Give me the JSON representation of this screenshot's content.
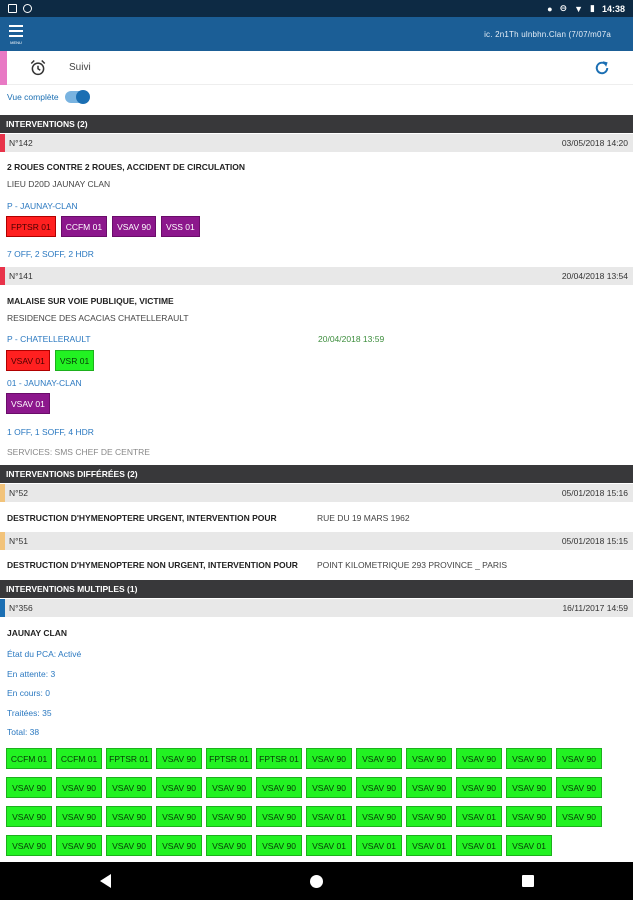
{
  "status": {
    "time": "14:38"
  },
  "appbar": {
    "menu_label": "MENU",
    "user": "ic. 2n1Th ulnbhn.Clan (7/07/m07a"
  },
  "toolbar": {
    "title": "Suivi"
  },
  "view": {
    "label": "Vue complète"
  },
  "sections": {
    "interventions": "INTERVENTIONS (2)",
    "differees": "INTERVENTIONS DIFFÉRÉES (2)",
    "multiples": "INTERVENTIONS MULTIPLES (1)"
  },
  "i142": {
    "num": "N°142",
    "date": "03/05/2018 14:20",
    "title": "2 ROUES CONTRE 2 ROUES, ACCIDENT DE CIRCULATION",
    "address": "LIEU D20D JAUNAY CLAN",
    "station": "P - JAUNAY-CLAN",
    "badges": [
      "FPTSR 01",
      "CCFM 01",
      "VSAV 90",
      "VSS 01"
    ],
    "personnel": "7 OFF, 2 SOFF, 2 HDR"
  },
  "i141": {
    "num": "N°141",
    "date": "20/04/2018 13:54",
    "title": "MALAISE SUR VOIE PUBLIQUE, VICTIME",
    "address": "RESIDENCE DES ACACIAS CHATELLERAULT",
    "station1": "P - CHATELLERAULT",
    "station1_date": "20/04/2018 13:59",
    "badges1": [
      "VSAV 01",
      "VSR 01"
    ],
    "station2": "01 - JAUNAY-CLAN",
    "badges2": [
      "VSAV 01"
    ],
    "personnel": "1 OFF, 1 SOFF, 4 HDR",
    "services": "SERVICES: SMS CHEF DE CENTRE"
  },
  "i52": {
    "num": "N°52",
    "date": "05/01/2018 15:16",
    "title": "DESTRUCTION D'HYMENOPTERE URGENT, INTERVENTION POUR",
    "address": "RUE DU 19 MARS 1962"
  },
  "i51": {
    "num": "N°51",
    "date": "05/01/2018 15:15",
    "title": "DESTRUCTION D'HYMENOPTERE NON URGENT, INTERVENTION POUR",
    "address": "POINT KILOMETRIQUE 293 PROVINCE _ PARIS"
  },
  "i356": {
    "num": "N°356",
    "date": "16/11/2017 14:59",
    "title": "JAUNAY CLAN",
    "pca": "État du PCA: Activé",
    "attente": "En attente: 3",
    "encours": "En cours: 0",
    "traitees": "Traitées: 35",
    "total": "Total: 38",
    "grid": [
      [
        "CCFM 01",
        "CCFM 01",
        "FPTSR 01",
        "VSAV 90",
        "FPTSR 01",
        "FPTSR 01",
        "VSAV 90",
        "VSAV 90",
        "VSAV 90",
        "VSAV 90",
        "VSAV 90",
        "VSAV 90"
      ],
      [
        "VSAV 90",
        "VSAV 90",
        "VSAV 90",
        "VSAV 90",
        "VSAV 90",
        "VSAV 90",
        "VSAV 90",
        "VSAV 90",
        "VSAV 90",
        "VSAV 90",
        "VSAV 90",
        "VSAV 90"
      ],
      [
        "VSAV 90",
        "VSAV 90",
        "VSAV 90",
        "VSAV 90",
        "VSAV 90",
        "VSAV 90",
        "VSAV 01",
        "VSAV 90",
        "VSAV 90",
        "VSAV 01",
        "VSAV 90",
        "VSAV 90"
      ],
      [
        "VSAV 90",
        "VSAV 90",
        "VSAV 90",
        "VSAV 90",
        "VSAV 90",
        "VSAV 90",
        "VSAV 01",
        "VSAV 01",
        "VSAV 01",
        "VSAV 01",
        "VSAV 01"
      ]
    ]
  },
  "colors": {
    "appbar": "#1b5e96",
    "section": "#38383a",
    "badge_red": "#ff2020",
    "badge_purple": "#8c178c",
    "badge_green": "#22f222"
  }
}
